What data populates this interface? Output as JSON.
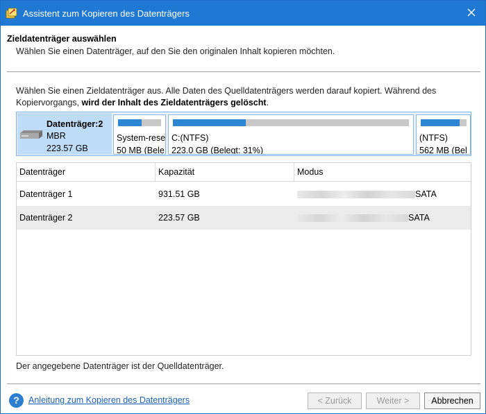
{
  "window": {
    "title": "Assistent zum Kopieren des Datenträgers"
  },
  "header": {
    "heading": "Zieldatenträger auswählen",
    "subheading": "Wählen Sie einen Datenträger, auf den Sie den originalen Inhalt kopieren möchten."
  },
  "info": {
    "text_plain_1": "Wählen Sie einen Zieldatenträger aus. Alle Daten des Quelldatenträgers werden darauf kopiert. Während des Kopiervorgangs, ",
    "text_bold": "wird der Inhalt des Zieldatenträgers gelöscht",
    "text_plain_2": "."
  },
  "disk_map": {
    "name": "Datenträger:2",
    "type": "MBR",
    "size": "223.57 GB",
    "partitions": [
      {
        "name": "System-rese",
        "info": "50 MB (Bele",
        "used_fraction": 0.55
      },
      {
        "name": "C:(NTFS)",
        "info": "223.0 GB (Belegt: 31%)",
        "used_fraction": 0.31
      },
      {
        "name": "(NTFS)",
        "info": "562 MB (Bel",
        "used_fraction": 0.85
      }
    ]
  },
  "table": {
    "columns": [
      "Datenträger",
      "Kapazität",
      "Modus"
    ],
    "rows": [
      {
        "disk": "Datenträger 1",
        "capacity": "931.51 GB",
        "mode_suffix": "SATA",
        "selected": false
      },
      {
        "disk": "Datenträger 2",
        "capacity": "223.57 GB",
        "mode_suffix": "SATA",
        "selected": true
      }
    ]
  },
  "note": "Der angegebene Datenträger ist der Quelldatenträger.",
  "footer": {
    "help_link": "Anleitung zum Kopieren des Datenträgers",
    "back_label": "< Zurück",
    "next_label": "Weiter >",
    "cancel_label": "Abbrechen"
  },
  "colors": {
    "titlebar": "#1f78d1",
    "accent": "#2c86d4",
    "selected_disk_bg": "#bfdcf7"
  }
}
